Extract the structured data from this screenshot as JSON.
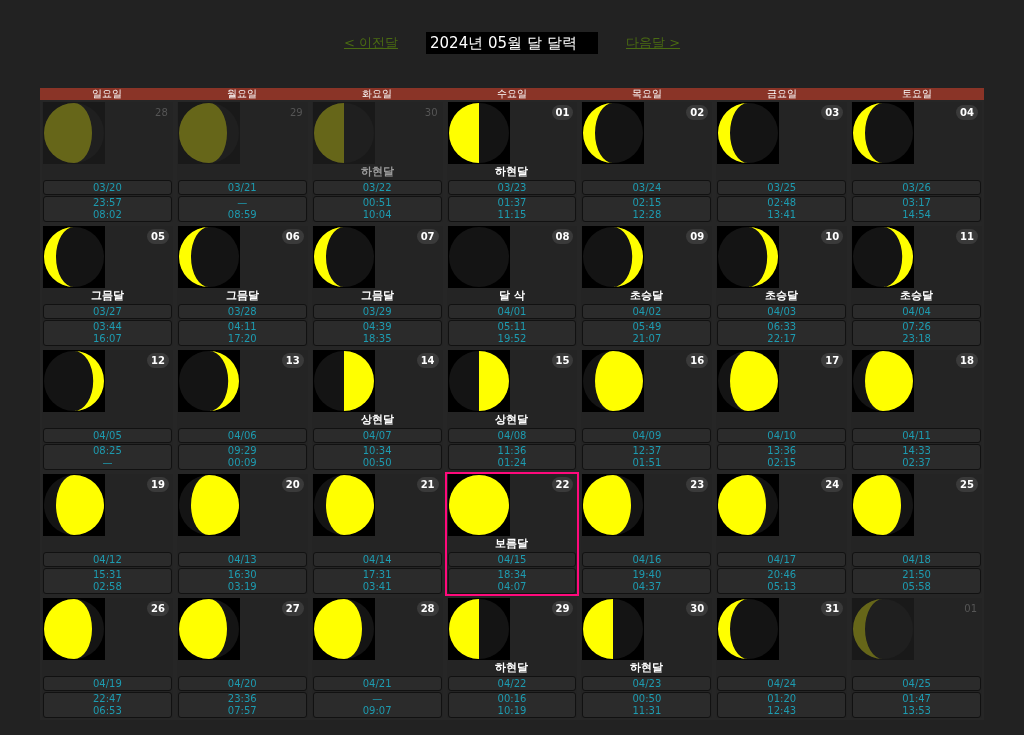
{
  "nav": {
    "prev": "< 이전달",
    "title": "2024년 05월 달 달력",
    "next": "다음달 >"
  },
  "weekdays": [
    "일요일",
    "월요일",
    "화요일",
    "수요일",
    "목요일",
    "금요일",
    "토요일"
  ],
  "days": [
    {
      "day": "28",
      "other_month": true,
      "selected": false,
      "kind": "waning-gibbous",
      "lunar": "03/20",
      "rise": "23:57",
      "set": "08:02"
    },
    {
      "day": "29",
      "other_month": true,
      "selected": false,
      "kind": "waning-gibbous",
      "lunar": "03/21",
      "rise": "—",
      "set": "08:59"
    },
    {
      "day": "30",
      "other_month": true,
      "selected": false,
      "kind": "last-quarter",
      "phase": "하현달",
      "lunar": "03/22",
      "rise": "00:51",
      "set": "10:04"
    },
    {
      "day": "01",
      "other_month": false,
      "selected": false,
      "kind": "last-quarter",
      "phase": "하현달",
      "lunar": "03/23",
      "rise": "01:37",
      "set": "11:15"
    },
    {
      "day": "02",
      "other_month": false,
      "selected": false,
      "kind": "waning-crescent",
      "lunar": "03/24",
      "rise": "02:15",
      "set": "12:28"
    },
    {
      "day": "03",
      "other_month": false,
      "selected": false,
      "kind": "waning-crescent",
      "lunar": "03/25",
      "rise": "02:48",
      "set": "13:41"
    },
    {
      "day": "04",
      "other_month": false,
      "selected": false,
      "kind": "waning-crescent",
      "lunar": "03/26",
      "rise": "03:17",
      "set": "14:54"
    },
    {
      "day": "05",
      "other_month": false,
      "selected": false,
      "kind": "waning-crescent",
      "phase": "그믐달",
      "lunar": "03/27",
      "rise": "03:44",
      "set": "16:07"
    },
    {
      "day": "06",
      "other_month": false,
      "selected": false,
      "kind": "waning-crescent",
      "phase": "그믐달",
      "lunar": "03/28",
      "rise": "04:11",
      "set": "17:20"
    },
    {
      "day": "07",
      "other_month": false,
      "selected": false,
      "kind": "waning-crescent",
      "phase": "그믐달",
      "lunar": "03/29",
      "rise": "04:39",
      "set": "18:35"
    },
    {
      "day": "08",
      "other_month": false,
      "selected": false,
      "kind": "new",
      "phase": "달 삭",
      "lunar": "04/01",
      "rise": "05:11",
      "set": "19:52"
    },
    {
      "day": "09",
      "other_month": false,
      "selected": false,
      "kind": "waxing-crescent",
      "phase": "초승달",
      "lunar": "04/02",
      "rise": "05:49",
      "set": "21:07"
    },
    {
      "day": "10",
      "other_month": false,
      "selected": false,
      "kind": "waxing-crescent",
      "phase": "초승달",
      "lunar": "04/03",
      "rise": "06:33",
      "set": "22:17"
    },
    {
      "day": "11",
      "other_month": false,
      "selected": false,
      "kind": "waxing-crescent",
      "phase": "초승달",
      "lunar": "04/04",
      "rise": "07:26",
      "set": "23:18"
    },
    {
      "day": "12",
      "other_month": false,
      "selected": false,
      "kind": "waxing-crescent",
      "lunar": "04/05",
      "rise": "08:25",
      "set": "—"
    },
    {
      "day": "13",
      "other_month": false,
      "selected": false,
      "kind": "waxing-crescent",
      "lunar": "04/06",
      "rise": "09:29",
      "set": "00:09"
    },
    {
      "day": "14",
      "other_month": false,
      "selected": false,
      "kind": "first-quarter",
      "phase": "상현달",
      "lunar": "04/07",
      "rise": "10:34",
      "set": "00:50"
    },
    {
      "day": "15",
      "other_month": false,
      "selected": false,
      "kind": "first-quarter",
      "phase": "상현달",
      "lunar": "04/08",
      "rise": "11:36",
      "set": "01:24"
    },
    {
      "day": "16",
      "other_month": false,
      "selected": false,
      "kind": "waxing-gibbous",
      "lunar": "04/09",
      "rise": "12:37",
      "set": "01:51"
    },
    {
      "day": "17",
      "other_month": false,
      "selected": false,
      "kind": "waxing-gibbous",
      "lunar": "04/10",
      "rise": "13:36",
      "set": "02:15"
    },
    {
      "day": "18",
      "other_month": false,
      "selected": false,
      "kind": "waxing-gibbous",
      "lunar": "04/11",
      "rise": "14:33",
      "set": "02:37"
    },
    {
      "day": "19",
      "other_month": false,
      "selected": false,
      "kind": "waxing-gibbous",
      "lunar": "04/12",
      "rise": "15:31",
      "set": "02:58"
    },
    {
      "day": "20",
      "other_month": false,
      "selected": false,
      "kind": "waxing-gibbous",
      "lunar": "04/13",
      "rise": "16:30",
      "set": "03:19"
    },
    {
      "day": "21",
      "other_month": false,
      "selected": false,
      "kind": "waxing-gibbous",
      "lunar": "04/14",
      "rise": "17:31",
      "set": "03:41"
    },
    {
      "day": "22",
      "other_month": false,
      "selected": true,
      "kind": "full",
      "phase": "보름달",
      "lunar": "04/15",
      "rise": "18:34",
      "set": "04:07"
    },
    {
      "day": "23",
      "other_month": false,
      "selected": false,
      "kind": "waning-gibbous",
      "lunar": "04/16",
      "rise": "19:40",
      "set": "04:37"
    },
    {
      "day": "24",
      "other_month": false,
      "selected": false,
      "kind": "waning-gibbous",
      "lunar": "04/17",
      "rise": "20:46",
      "set": "05:13"
    },
    {
      "day": "25",
      "other_month": false,
      "selected": false,
      "kind": "waning-gibbous",
      "lunar": "04/18",
      "rise": "21:50",
      "set": "05:58"
    },
    {
      "day": "26",
      "other_month": false,
      "selected": false,
      "kind": "waning-gibbous",
      "lunar": "04/19",
      "rise": "22:47",
      "set": "06:53"
    },
    {
      "day": "27",
      "other_month": false,
      "selected": false,
      "kind": "waning-gibbous",
      "lunar": "04/20",
      "rise": "23:36",
      "set": "07:57"
    },
    {
      "day": "28",
      "other_month": false,
      "selected": false,
      "kind": "waning-gibbous",
      "lunar": "04/21",
      "rise": "—",
      "set": "09:07"
    },
    {
      "day": "29",
      "other_month": false,
      "selected": false,
      "kind": "last-quarter",
      "phase": "하현달",
      "lunar": "04/22",
      "rise": "00:16",
      "set": "10:19"
    },
    {
      "day": "30",
      "other_month": false,
      "selected": false,
      "kind": "last-quarter",
      "phase": "하현달",
      "lunar": "04/23",
      "rise": "00:50",
      "set": "11:31"
    },
    {
      "day": "31",
      "other_month": false,
      "selected": false,
      "kind": "waning-crescent",
      "lunar": "04/24",
      "rise": "01:20",
      "set": "12:43"
    },
    {
      "day": "01",
      "other_month": true,
      "selected": false,
      "kind": "waning-crescent",
      "lunar": "04/25",
      "rise": "01:47",
      "set": "13:53"
    }
  ]
}
